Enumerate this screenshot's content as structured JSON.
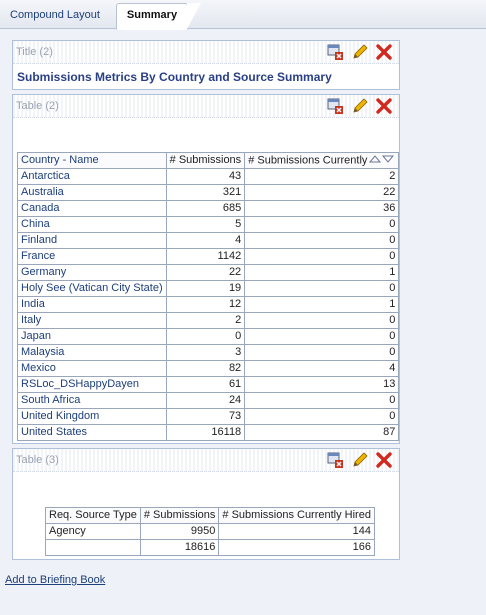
{
  "tabs": [
    {
      "label": "Compound Layout"
    },
    {
      "label": "Summary"
    }
  ],
  "title_panel": {
    "header": "Title (2)",
    "title": "Submissions Metrics By Country and Source Summary"
  },
  "table2": {
    "header": "Table (2)",
    "columns": [
      "Country - Name",
      "# Submissions",
      "# Submissions Currently"
    ],
    "rows": [
      {
        "name": "Antarctica",
        "subs": "43",
        "hired": "2"
      },
      {
        "name": "Australia",
        "subs": "321",
        "hired": "22"
      },
      {
        "name": "Canada",
        "subs": "685",
        "hired": "36"
      },
      {
        "name": "China",
        "subs": "5",
        "hired": "0"
      },
      {
        "name": "Finland",
        "subs": "4",
        "hired": "0"
      },
      {
        "name": "France",
        "subs": "1142",
        "hired": "0"
      },
      {
        "name": "Germany",
        "subs": "22",
        "hired": "1"
      },
      {
        "name": "Holy See (Vatican City State)",
        "subs": "19",
        "hired": "0"
      },
      {
        "name": "India",
        "subs": "12",
        "hired": "1"
      },
      {
        "name": "Italy",
        "subs": "2",
        "hired": "0"
      },
      {
        "name": "Japan",
        "subs": "0",
        "hired": "0"
      },
      {
        "name": "Malaysia",
        "subs": "3",
        "hired": "0"
      },
      {
        "name": "Mexico",
        "subs": "82",
        "hired": "4"
      },
      {
        "name": "RSLoc_DSHappyDayen",
        "subs": "61",
        "hired": "13"
      },
      {
        "name": "South Africa",
        "subs": "24",
        "hired": "0"
      },
      {
        "name": "United Kingdom",
        "subs": "73",
        "hired": "0"
      },
      {
        "name": "United States",
        "subs": "16118",
        "hired": "87"
      }
    ]
  },
  "table3": {
    "header": "Table (3)",
    "columns": [
      "Req. Source Type",
      "# Submissions",
      "# Submissions Currently Hired"
    ],
    "rows": [
      {
        "type": "Agency",
        "subs": "9950",
        "hired": "144"
      },
      {
        "type": "",
        "subs": "18616",
        "hired": "166"
      }
    ]
  },
  "footer": {
    "link": "Add to Briefing Book"
  },
  "colors": {
    "accent": "#1d3f7a",
    "title": "#2a3f86",
    "delete": "#d2281e",
    "edit": "#e0a800"
  }
}
